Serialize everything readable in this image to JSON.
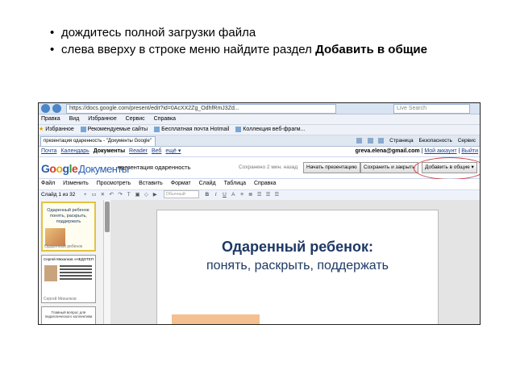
{
  "instructions": [
    {
      "text": "дождитесь полной загрузки файла",
      "bold": ""
    },
    {
      "text": "слева вверху в строке меню найдите раздел ",
      "bold": "Добавить в общие"
    }
  ],
  "browser": {
    "url": "https://docs.google.com/present/edit?id=0AcXX2Zg_OdhfRmJ3Zd...",
    "search_placeholder": "Live Search",
    "menu": [
      "Вид",
      "Избранное",
      "Сервис",
      "Справка"
    ],
    "menu_first": "Правка",
    "favorites_label": "Избранное",
    "favorites": [
      "Рекомендуемые сайты",
      "Бесплатная почта Hotmail",
      "Коллекция веб-фрагм..."
    ],
    "tab_title": "презентация одаренность - \"Документы Google\"",
    "tab_tools": [
      "Страница",
      "Безопасность",
      "Сервис"
    ]
  },
  "google_bar": {
    "links": [
      "Почта",
      "Календарь"
    ],
    "current": "Документы",
    "links2": [
      "Reader",
      "Веб",
      "ещё ▾"
    ],
    "email": "greva.elena@gmail.com",
    "account_links": [
      "Мой аккаунт",
      "Выйти"
    ]
  },
  "docs": {
    "logo_letters": [
      "G",
      "o",
      "o",
      "g",
      "l",
      "e"
    ],
    "logo_docs": "Документы",
    "doc_title": "презентация одаренность",
    "saved_status": "Сохранено 2 мин. назад",
    "buttons": {
      "start": "Начать презентацию",
      "save_close": "Сохранить и закрыть",
      "share": "Добавить в общие ▾"
    },
    "menu": [
      "Файл",
      "Изменить",
      "Просмотреть",
      "Вставить",
      "Формат",
      "Слайд",
      "Таблица",
      "Справка"
    ],
    "slide_count": "Слайд 1 из 32",
    "font_placeholder": "Обычный"
  },
  "thumbnails": [
    {
      "title": "Одаренный ребенок:",
      "subtitle": "понять, раскрыть, поддержать",
      "caption": "Одаренный ребенок"
    },
    {
      "title": "Сергей Михалков «НЕДОТЕПА»",
      "caption": "Сергей Михалков"
    },
    {
      "title": "Главный вопрос для педагогического коллектива"
    }
  ],
  "slide": {
    "title": "Одаренный ребенок:",
    "subtitle": "понять, раскрыть, поддержать"
  }
}
